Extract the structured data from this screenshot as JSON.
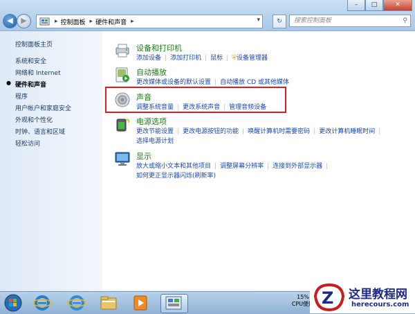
{
  "window": {
    "min": "–",
    "max": "□",
    "close": "✕"
  },
  "address": {
    "crumbs": [
      "控制面板",
      "硬件和声音"
    ]
  },
  "search": {
    "placeholder": "搜索控制面板"
  },
  "sidebar": {
    "items": [
      {
        "label": "控制面板主页",
        "active": false
      },
      {
        "label": "系统和安全",
        "active": false
      },
      {
        "label": "网络和 Internet",
        "active": false
      },
      {
        "label": "硬件和声音",
        "active": true
      },
      {
        "label": "程序",
        "active": false
      },
      {
        "label": "用户帐户和家庭安全",
        "active": false
      },
      {
        "label": "外观和个性化",
        "active": false
      },
      {
        "label": "时钟、语言和区域",
        "active": false
      },
      {
        "label": "轻松访问",
        "active": false
      }
    ]
  },
  "categories": [
    {
      "title": "设备和打印机",
      "icon": "printer-icon",
      "rows": [
        [
          "添加设备",
          "添加打印机",
          "鼠标",
          "设备管理器"
        ]
      ]
    },
    {
      "title": "自动播放",
      "icon": "autoplay-icon",
      "rows": [
        [
          "更改媒体或设备的默认设置",
          "自动播放 CD 或其他媒体"
        ]
      ]
    },
    {
      "title": "声音",
      "icon": "speaker-icon",
      "rows": [
        [
          "调整系统音量",
          "更改系统声音",
          "管理音频设备"
        ]
      ]
    },
    {
      "title": "电源选项",
      "icon": "power-options-icon",
      "rows": [
        [
          "更改节能设置",
          "更改电源按钮的功能",
          "唤醒计算机时需要密码",
          "更改计算机睡眠时间"
        ],
        [
          "选择电源计划"
        ]
      ]
    },
    {
      "title": "显示",
      "icon": "display-icon",
      "rows": [
        [
          "放大或缩小文本和其他项目",
          "调整屏幕分辨率",
          "连接到外部显示器"
        ],
        [
          "如何更正显示器闪烁(刷新率)"
        ]
      ]
    }
  ],
  "taskbar": {
    "cpu_percent": "15%",
    "cpu_label": "CPU使用"
  },
  "watermark": {
    "name": "这里教程网",
    "url": "herecours.com"
  },
  "colors": {
    "highlight": "#e21d1d",
    "link": "#1948b5",
    "category_title": "#1b7c14"
  }
}
